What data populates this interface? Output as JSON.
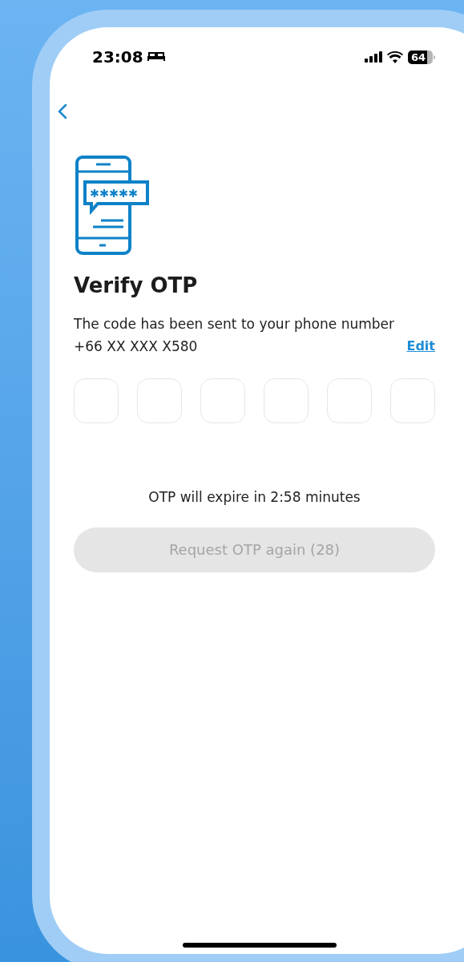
{
  "status_bar": {
    "time": "23:08",
    "battery": "64"
  },
  "title": "Verify OTP",
  "description": "The code has been sent to your phone number",
  "phone_number": "+66 XX XXX X580",
  "edit_link": "Edit",
  "otp_fields": [
    {
      "focused": false
    },
    {
      "focused": false
    },
    {
      "focused": false
    },
    {
      "focused": false
    },
    {
      "focused": false
    },
    {
      "focused": false
    }
  ],
  "expiry_text": "OTP will expire in 2:58 minutes",
  "resend_button": {
    "label": "Request OTP again (28)",
    "disabled": true
  }
}
